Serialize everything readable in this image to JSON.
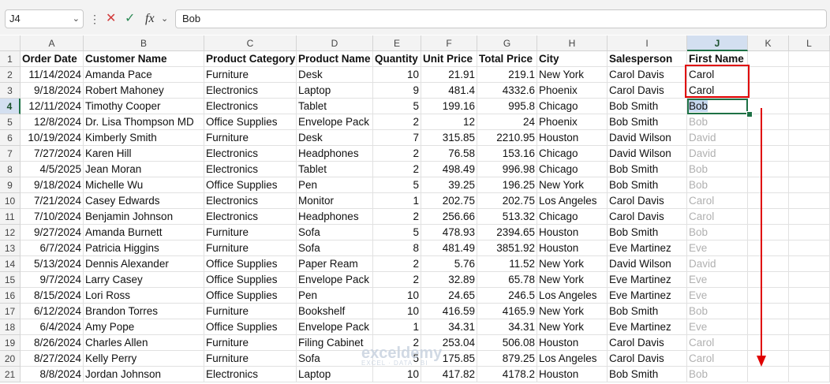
{
  "formula_bar": {
    "name_box": "J4",
    "formula_value": "Bob",
    "fx_label": "fx"
  },
  "columns": [
    "A",
    "B",
    "C",
    "D",
    "E",
    "F",
    "G",
    "H",
    "I",
    "J",
    "K",
    "L"
  ],
  "headers": [
    "Order Date",
    "Customer Name",
    "Product Category",
    "Product Name",
    "Quantity",
    "Unit Price",
    "Total Price",
    "City",
    "Salesperson",
    "First Name"
  ],
  "rows": [
    [
      "11/14/2024",
      "Amanda Pace",
      "Furniture",
      "Desk",
      "10",
      "21.91",
      "219.1",
      "New York",
      "Carol Davis",
      "Carol"
    ],
    [
      "9/18/2024",
      "Robert Mahoney",
      "Electronics",
      "Laptop",
      "9",
      "481.4",
      "4332.6",
      "Phoenix",
      "Carol Davis",
      "Carol"
    ],
    [
      "12/11/2024",
      "Timothy Cooper",
      "Electronics",
      "Tablet",
      "5",
      "199.16",
      "995.8",
      "Chicago",
      "Bob Smith",
      "Bob"
    ],
    [
      "12/8/2024",
      "Dr. Lisa Thompson MD",
      "Office Supplies",
      "Envelope Pack",
      "2",
      "12",
      "24",
      "Phoenix",
      "Bob Smith",
      "Bob"
    ],
    [
      "10/19/2024",
      "Kimberly Smith",
      "Furniture",
      "Desk",
      "7",
      "315.85",
      "2210.95",
      "Houston",
      "David Wilson",
      "David"
    ],
    [
      "7/27/2024",
      "Karen Hill",
      "Electronics",
      "Headphones",
      "2",
      "76.58",
      "153.16",
      "Chicago",
      "David Wilson",
      "David"
    ],
    [
      "4/5/2025",
      "Jean Moran",
      "Electronics",
      "Tablet",
      "2",
      "498.49",
      "996.98",
      "Chicago",
      "Bob Smith",
      "Bob"
    ],
    [
      "9/18/2024",
      "Michelle Wu",
      "Office Supplies",
      "Pen",
      "5",
      "39.25",
      "196.25",
      "New York",
      "Bob Smith",
      "Bob"
    ],
    [
      "7/21/2024",
      "Casey Edwards",
      "Electronics",
      "Monitor",
      "1",
      "202.75",
      "202.75",
      "Los Angeles",
      "Carol Davis",
      "Carol"
    ],
    [
      "7/10/2024",
      "Benjamin Johnson",
      "Electronics",
      "Headphones",
      "2",
      "256.66",
      "513.32",
      "Chicago",
      "Carol Davis",
      "Carol"
    ],
    [
      "9/27/2024",
      "Amanda Burnett",
      "Furniture",
      "Sofa",
      "5",
      "478.93",
      "2394.65",
      "Houston",
      "Bob Smith",
      "Bob"
    ],
    [
      "6/7/2024",
      "Patricia Higgins",
      "Furniture",
      "Sofa",
      "8",
      "481.49",
      "3851.92",
      "Houston",
      "Eve Martinez",
      "Eve"
    ],
    [
      "5/13/2024",
      "Dennis Alexander",
      "Office Supplies",
      "Paper Ream",
      "2",
      "5.76",
      "11.52",
      "New York",
      "David Wilson",
      "David"
    ],
    [
      "9/7/2024",
      "Larry Casey",
      "Office Supplies",
      "Envelope Pack",
      "2",
      "32.89",
      "65.78",
      "New York",
      "Eve Martinez",
      "Eve"
    ],
    [
      "8/15/2024",
      "Lori Ross",
      "Office Supplies",
      "Pen",
      "10",
      "24.65",
      "246.5",
      "Los Angeles",
      "Eve Martinez",
      "Eve"
    ],
    [
      "6/12/2024",
      "Brandon Torres",
      "Furniture",
      "Bookshelf",
      "10",
      "416.59",
      "4165.9",
      "New York",
      "Bob Smith",
      "Bob"
    ],
    [
      "6/4/2024",
      "Amy Pope",
      "Office Supplies",
      "Envelope Pack",
      "1",
      "34.31",
      "34.31",
      "New York",
      "Eve Martinez",
      "Eve"
    ],
    [
      "8/26/2024",
      "Charles Allen",
      "Furniture",
      "Filing Cabinet",
      "2",
      "253.04",
      "506.08",
      "Houston",
      "Carol Davis",
      "Carol"
    ],
    [
      "8/27/2024",
      "Kelly Perry",
      "Furniture",
      "Sofa",
      "5",
      "175.85",
      "879.25",
      "Los Angeles",
      "Carol Davis",
      "Carol"
    ],
    [
      "8/8/2024",
      "Jordan Johnson",
      "Electronics",
      "Laptop",
      "10",
      "417.82",
      "4178.2",
      "Houston",
      "Bob Smith",
      "Bob"
    ]
  ],
  "watermark": {
    "brand": "exceldemy",
    "tagline": "EXCEL · DATA · BI"
  },
  "colors": {
    "selection_green": "#1e7145",
    "highlight_red": "#e00000",
    "ghost_text": "#b0b0b0"
  }
}
